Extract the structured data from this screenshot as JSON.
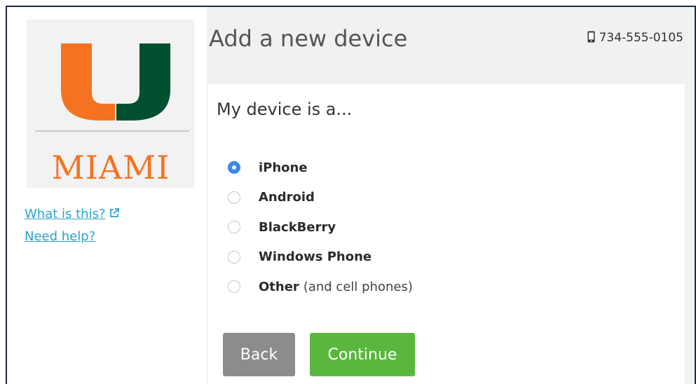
{
  "brand": {
    "logo_text": "MIAMI",
    "colors": {
      "orange": "#f47321",
      "green": "#005030"
    }
  },
  "sidebar": {
    "links": [
      {
        "label": "What is this?",
        "icon": "external-link-icon"
      },
      {
        "label": "Need help?"
      }
    ]
  },
  "header": {
    "title": "Add a new device",
    "phone": "734-555-0105",
    "phone_icon": "mobile-phone-icon"
  },
  "form": {
    "prompt": "My device is a...",
    "selected": "iPhone",
    "options": [
      {
        "label": "iPhone",
        "extra": ""
      },
      {
        "label": "Android",
        "extra": ""
      },
      {
        "label": "BlackBerry",
        "extra": ""
      },
      {
        "label": "Windows Phone",
        "extra": ""
      },
      {
        "label": "Other",
        "extra": "(and cell phones)"
      }
    ]
  },
  "buttons": {
    "back": "Back",
    "continue": "Continue"
  },
  "colors": {
    "radio_selected": "#3b87e8",
    "link": "#2aa3c9",
    "back_button": "#8c8c8c",
    "continue_button": "#5ab73e"
  }
}
